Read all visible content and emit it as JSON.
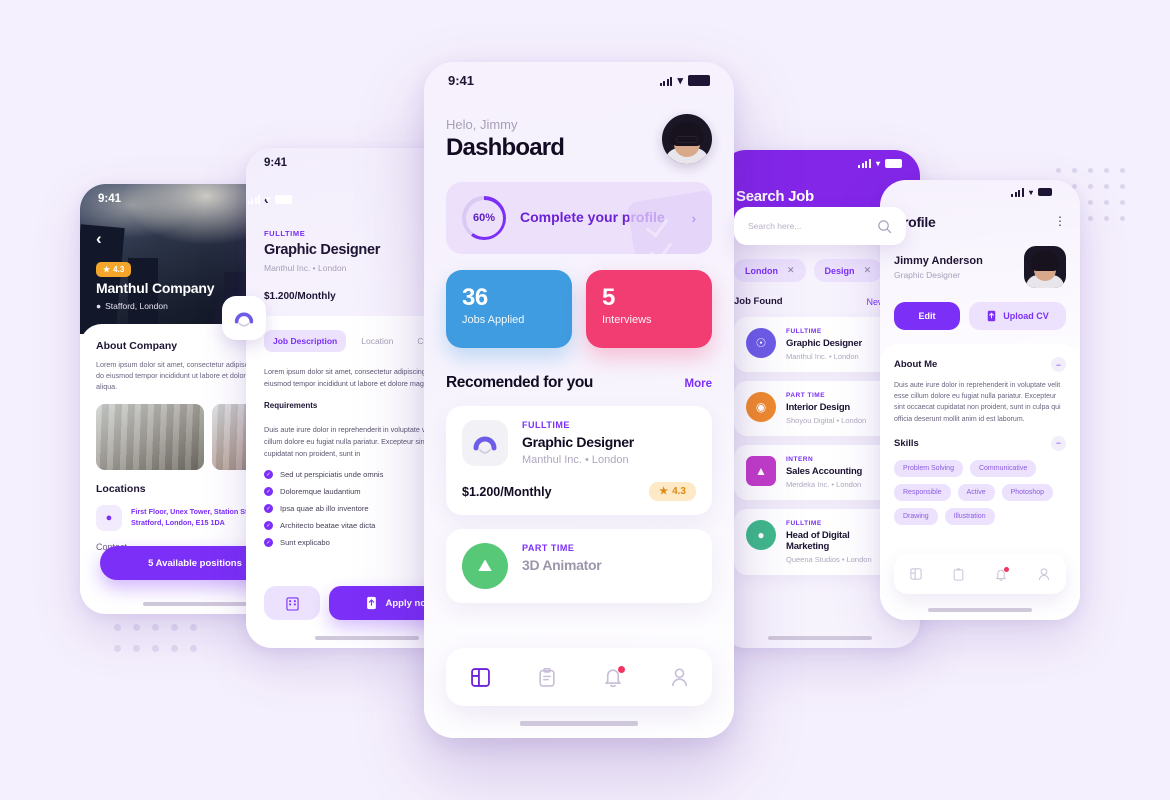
{
  "background_color": "#f5f0fd",
  "accent_color": "#7b2ff7",
  "company_screen": {
    "status_time": "9:41",
    "back_icon": "chevron-left-icon",
    "rating": "4.3",
    "company_name": "Manthul Company",
    "location": "Stafford, London",
    "about_heading": "About Company",
    "about_text": "Lorem ipsum dolor sit amet, consectetur adipiscing elit, sed do eiusmod tempor incididunt ut labore et dolore magna aliqua.",
    "locations_heading": "Locations",
    "address": "First Floor, Unex Tower, Station Street, Stratford, London, E15 1DA",
    "contact_heading": "Contact",
    "cta_label": "5 Available positions"
  },
  "job_detail_screen": {
    "status_time": "9:41",
    "back_icon": "chevron-left-icon",
    "share_icon": "share-icon",
    "bookmark_icon": "bookmark-icon",
    "employment_type": "FULLTIME",
    "job_title": "Graphic Designer",
    "company_location": "Manthul Inc.  •  London",
    "salary": "$1.200/Monthly",
    "tabs": [
      {
        "label": "Job Description",
        "active": true
      },
      {
        "label": "Location",
        "active": false
      },
      {
        "label": "Company",
        "active": false
      }
    ],
    "description": "Lorem ipsum dolor sit amet, consectetur adipiscing elit, sed do eiusmod tempor incididunt ut labore et dolore magna aliqua.",
    "requirements_heading": "Requirements",
    "requirements_intro": "Duis aute irure dolor in reprehenderit in voluptate velit esse cillum dolore eu fugiat nulla pariatur. Excepteur sint occaecat cupidatat non proident, sunt in",
    "requirements": [
      "Sed ut perspiciatis unde omnis",
      "Doloremque laudantium",
      "Ipsa quae ab illo inventore",
      "Architecto beatae vitae dicta",
      "Sunt explicabo"
    ],
    "secondary_button_icon": "company-icon",
    "apply_label": "Apply now",
    "apply_icon": "file-upload-icon"
  },
  "dashboard_screen": {
    "status_time": "9:41",
    "greeting": "Helo, Jimmy",
    "title": "Dashboard",
    "avatar": "user-avatar",
    "profile_card": {
      "percent": "60%",
      "progress": 60,
      "label": "Complete your profile",
      "chevron": "chevron-right-icon"
    },
    "stats": [
      {
        "number": "36",
        "label": "Jobs Applied",
        "color": "#3f9ce0"
      },
      {
        "number": "5",
        "label": "Interviews",
        "color": "#f23d73"
      }
    ],
    "section_title": "Recomended for you",
    "more_label": "More",
    "jobs": [
      {
        "employment_type": "FULLTIME",
        "title": "Graphic Designer",
        "company_location": "Manthul Inc.  •  London",
        "salary": "$1.200/Monthly",
        "rating": "4.3",
        "logo": "manthul-logo"
      },
      {
        "employment_type": "PART TIME",
        "title": "3D Animator",
        "logo": "animator-logo"
      }
    ],
    "nav": [
      {
        "icon": "dashboard-icon",
        "active": true
      },
      {
        "icon": "clipboard-icon",
        "active": false
      },
      {
        "icon": "bell-icon",
        "active": false,
        "badge": true
      },
      {
        "icon": "person-icon",
        "active": false
      }
    ]
  },
  "search_screen": {
    "title": "Search Job",
    "filter_icon": "sliders-icon",
    "search_placeholder": "Search here...",
    "search_icon": "search-icon",
    "chips": [
      {
        "label": "London",
        "remove_icon": "close-icon"
      },
      {
        "label": "Design",
        "remove_icon": "close-icon"
      }
    ],
    "found_label": "Job Found",
    "sort_label": "Newest",
    "sort_icon": "chevron-down-icon",
    "results": [
      {
        "employment_type": "FULLTIME",
        "title": "Graphic Designer",
        "company_location": "Manthul Inc.  •  London",
        "logo_color": "#6c5ce7"
      },
      {
        "employment_type": "PART TIME",
        "title": "Interior Design",
        "company_location": "Shoyou Digital  •  London",
        "logo_color": "#f08a2c"
      },
      {
        "employment_type": "INTERN",
        "title": "Sales Accounting",
        "company_location": "Merdeka Inc.  •  London",
        "logo_color": "#c13cc8"
      },
      {
        "employment_type": "FULLTIME",
        "title": "Head of Digital Marketing",
        "company_location": "Queena Studios  •  London",
        "logo_color": "#3fb98a"
      }
    ]
  },
  "profile_screen": {
    "title": "Profile",
    "menu_icon": "more-vertical-icon",
    "name": "Jimmy Anderson",
    "role": "Graphic Designer",
    "edit_label": "Edit",
    "upload_label": "Upload CV",
    "upload_icon": "file-upload-icon",
    "about_heading": "About Me",
    "about_text": "Duis aute irure dolor in reprehenderit in voluptate velit esse cillum dolore eu fugiat nulla pariatur. Excepteur sint occaecat cupidatat non proident, sunt in culpa qui officia deserunt mollit anim id est laborum.",
    "skills_heading": "Skills",
    "collapse_icon": "minus-icon",
    "skills": [
      "Problem Solving",
      "Communicative",
      "Responsible",
      "Active",
      "Photoshop",
      "Drawing",
      "Illustration"
    ],
    "nav": [
      {
        "icon": "dashboard-icon"
      },
      {
        "icon": "clipboard-icon"
      },
      {
        "icon": "bell-icon",
        "badge": true
      },
      {
        "icon": "person-icon"
      }
    ]
  }
}
